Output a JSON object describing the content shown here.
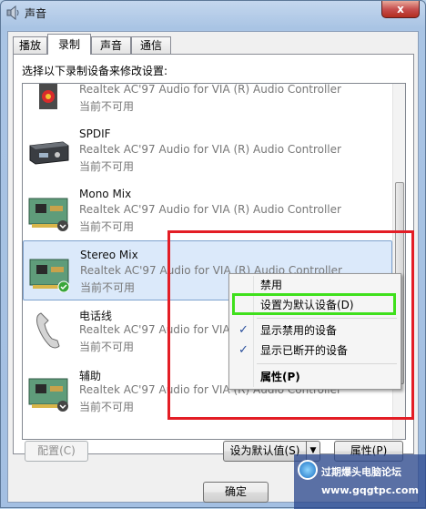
{
  "window": {
    "title": "声音",
    "close_label": "x"
  },
  "tabs": [
    {
      "label": "播放"
    },
    {
      "label": "录制",
      "active": true
    },
    {
      "label": "声音"
    },
    {
      "label": "通信"
    }
  ],
  "instruction": "选择以下录制设备来修改设置:",
  "devices": [
    {
      "name": "",
      "description": "Realtek AC'97 Audio for VIA (R) Audio Controller",
      "status": "当前不可用",
      "icon": "line-in-jack-icon"
    },
    {
      "name": "SPDIF",
      "description": "Realtek AC'97 Audio for VIA (R) Audio Controller",
      "status": "当前不可用",
      "icon": "spdif-device-icon"
    },
    {
      "name": "Mono Mix",
      "description": "Realtek AC'97 Audio for VIA (R) Audio Controller",
      "status": "当前不可用",
      "icon": "sound-card-icon"
    },
    {
      "name": "Stereo Mix",
      "description": "Realtek AC'97 Audio for VIA (R) Audio Controller",
      "status": "当前不可用",
      "icon": "sound-card-icon",
      "selected": true
    },
    {
      "name": "电话线",
      "description": "Realtek AC'97 Audio for VIA (R) Audio Controller",
      "status": "当前不可用",
      "icon": "telephone-icon"
    },
    {
      "name": "辅助",
      "description": "Realtek AC'97 Audio for VIA (R) Audio Controller",
      "status": "当前不可用",
      "icon": "sound-card-icon"
    }
  ],
  "buttons": {
    "configure": "配置(C)",
    "set_default": "设为默认值(S)",
    "properties": "属性(P)",
    "ok": "确定"
  },
  "context_menu": {
    "items": [
      {
        "label": "禁用",
        "checked": false
      },
      {
        "label": "设置为默认设备(D)",
        "checked": false
      },
      {
        "label": "显示禁用的设备",
        "checked": true
      },
      {
        "label": "显示已断开的设备",
        "checked": true
      },
      {
        "label": "属性(P)",
        "checked": false,
        "bold": true
      }
    ]
  },
  "watermark": {
    "site_name": "过期爆头电脑论坛",
    "url": "www.gqgtpc.com"
  },
  "colors": {
    "highlight_red": "#e31d25",
    "highlight_green": "#3fe01c",
    "selection": "#dbe9fa",
    "check": "#2a4f9c"
  }
}
